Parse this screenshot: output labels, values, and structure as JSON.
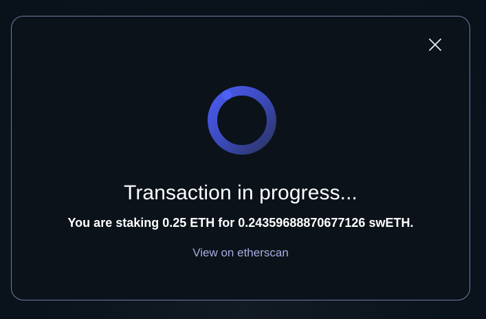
{
  "modal": {
    "title": "Transaction in progress...",
    "message": "You are staking 0.25 ETH for 0.24359688870677126 swETH.",
    "link_label": "View on etherscan"
  },
  "icons": {
    "close": "close-icon",
    "spinner": "loading-spinner-icon"
  },
  "colors": {
    "border": "#6f7ca8",
    "link": "#a5addd",
    "spinner_head": "#4a5cf2",
    "spinner_tail": "#2c3766"
  }
}
